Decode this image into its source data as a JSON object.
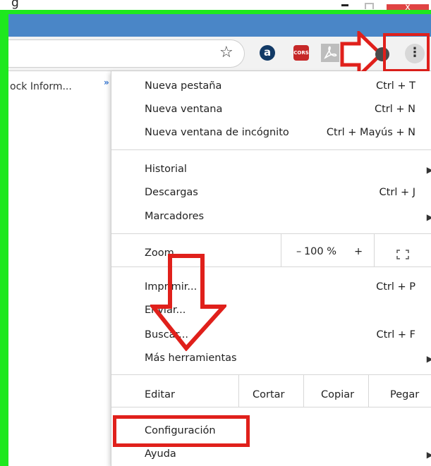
{
  "window": {
    "title_fragment": "g",
    "close_label": "x"
  },
  "toolbar": {
    "star_icon": "star-icon",
    "extensions": [
      {
        "name": "a-extension-icon",
        "label": "a"
      },
      {
        "name": "cors-extension-icon",
        "label": "CORS"
      },
      {
        "name": "pdf-extension-icon"
      },
      {
        "name": "dark-extension-icon"
      }
    ],
    "menu_icon": "three-dots-icon",
    "menu_glyph": "⋮"
  },
  "bookmarks": {
    "item_label": "ock Inform...",
    "overflow_glyph": "»"
  },
  "menu": {
    "new_tab": {
      "label": "Nueva pestaña",
      "shortcut": "Ctrl + T"
    },
    "new_window": {
      "label": "Nueva ventana",
      "shortcut": "Ctrl + N"
    },
    "incognito": {
      "label": "Nueva ventana de incógnito",
      "shortcut": "Ctrl + Mayús + N"
    },
    "history": {
      "label": "Historial"
    },
    "downloads": {
      "label": "Descargas",
      "shortcut": "Ctrl + J"
    },
    "bookmarks": {
      "label": "Marcadores"
    },
    "zoom": {
      "label": "Zoom",
      "minus": "–",
      "value": "100 %",
      "plus": "+"
    },
    "print": {
      "label": "Imprimir...",
      "shortcut": "Ctrl + P"
    },
    "cast": {
      "label": "Enviar..."
    },
    "find": {
      "label": "Buscar...",
      "shortcut": "Ctrl + F"
    },
    "more_tools": {
      "label": "Más herramientas"
    },
    "edit": {
      "label": "Editar",
      "cut": "Cortar",
      "copy": "Copiar",
      "paste": "Pegar"
    },
    "settings": {
      "label": "Configuración"
    },
    "help": {
      "label": "Ayuda"
    },
    "submenu_glyph": "▶"
  },
  "colors": {
    "highlight": "#e0201b",
    "frame": "#1ee81e",
    "titlebar": "#4a86c7"
  }
}
